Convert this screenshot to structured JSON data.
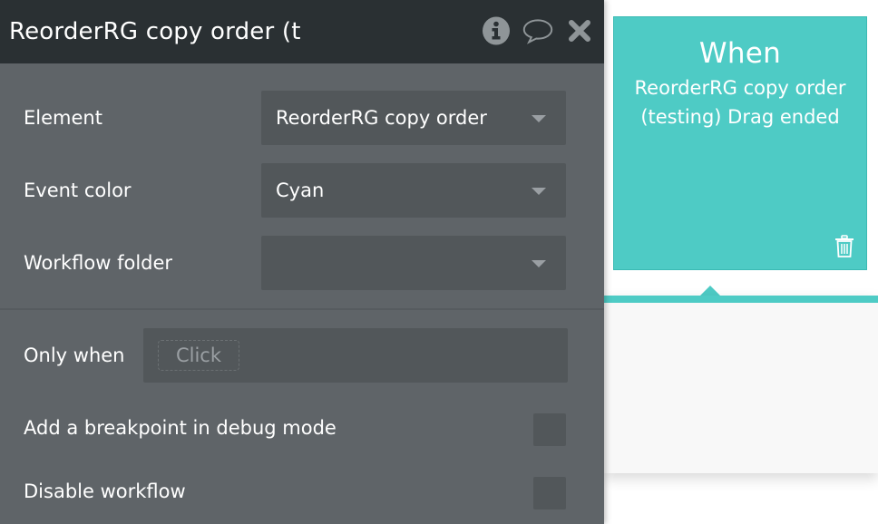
{
  "panel": {
    "title": "ReorderRG copy order (t",
    "header_icons": [
      "info-icon",
      "comment-icon",
      "close-icon"
    ],
    "fields": {
      "element": {
        "label": "Element",
        "value": "ReorderRG copy order"
      },
      "event_color": {
        "label": "Event color",
        "value": "Cyan"
      },
      "workflow_folder": {
        "label": "Workflow folder",
        "value": ""
      }
    },
    "only_when": {
      "label": "Only when",
      "placeholder": "Click"
    },
    "breakpoint": {
      "label": "Add a breakpoint in debug mode",
      "checked": false
    },
    "disable": {
      "label": "Disable workflow",
      "checked": false
    }
  },
  "event_card": {
    "heading": "When",
    "description": "ReorderRG copy order (testing) Drag ended",
    "color": "#4ecbc5"
  }
}
